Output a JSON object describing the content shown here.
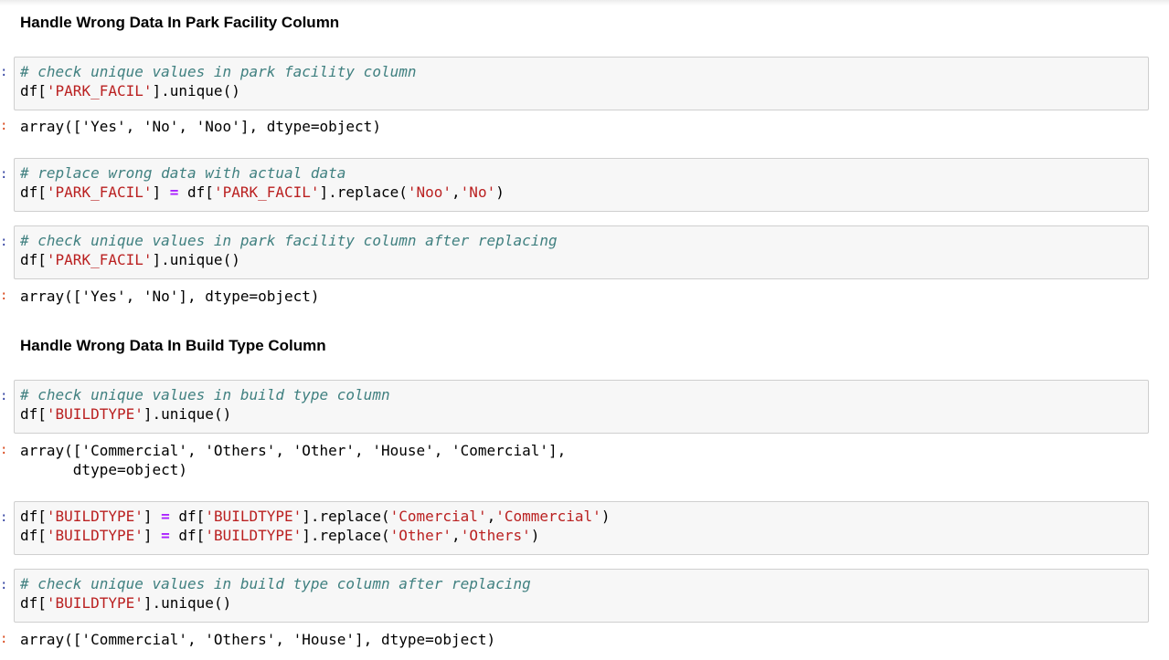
{
  "headings": {
    "park": "Handle Wrong Data In Park Facility Column",
    "build": "Handle Wrong Data In Build Type Column"
  },
  "prompt_char": ":",
  "cells": [
    {
      "comment": "# check unique values in park facility column",
      "line2": {
        "a": "df[",
        "s1": "'PARK_FACIL'",
        "b": "].unique()"
      },
      "output": "array(['Yes', 'No', 'Noo'], dtype=object)"
    },
    {
      "comment": "# replace wrong data with actual data",
      "line2": {
        "a": "df[",
        "s1": "'PARK_FACIL'",
        "b": "] ",
        "op": "=",
        "c": " df[",
        "s2": "'PARK_FACIL'",
        "d": "].replace(",
        "s3": "'Noo'",
        "e": ",",
        "s4": "'No'",
        "f": ")"
      }
    },
    {
      "comment": "# check unique values in park facility column after replacing",
      "line2": {
        "a": "df[",
        "s1": "'PARK_FACIL'",
        "b": "].unique()"
      },
      "output": "array(['Yes', 'No'], dtype=object)"
    },
    {
      "comment": "# check unique values in build type column",
      "line2": {
        "a": "df[",
        "s1": "'BUILDTYPE'",
        "b": "].unique()"
      },
      "output_line1": "array(['Commercial', 'Others', 'Other', 'House', 'Comercial'],",
      "output_line2": "      dtype=object)"
    },
    {
      "line1": {
        "a": "df[",
        "s1": "'BUILDTYPE'",
        "b": "] ",
        "op": "=",
        "c": " df[",
        "s2": "'BUILDTYPE'",
        "d": "].replace(",
        "s3": "'Comercial'",
        "e": ",",
        "s4": "'Commercial'",
        "f": ")"
      },
      "line2": {
        "a": "df[",
        "s1": "'BUILDTYPE'",
        "b": "] ",
        "op": "=",
        "c": " df[",
        "s2": "'BUILDTYPE'",
        "d": "].replace(",
        "s3": "'Other'",
        "e": ",",
        "s4": "'Others'",
        "f": ")"
      }
    },
    {
      "comment": "# check unique values in build type column after replacing",
      "line2": {
        "a": "df[",
        "s1": "'BUILDTYPE'",
        "b": "].unique()"
      },
      "output": "array(['Commercial', 'Others', 'House'], dtype=object)"
    }
  ]
}
